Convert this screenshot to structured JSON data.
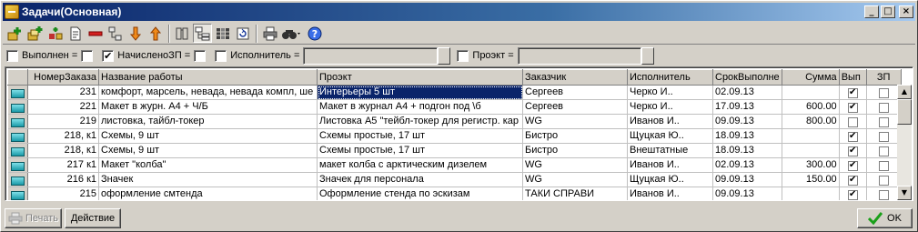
{
  "window": {
    "title": "Задачи(Основная)",
    "controls": {
      "minimize": "_",
      "maximize": "□",
      "close": "×"
    }
  },
  "toolbar": {
    "icons": [
      "add-icon",
      "add-copy-icon",
      "move-icon",
      "document-icon",
      "delete-icon",
      "tree-icon",
      "arrow-down-icon",
      "arrow-up-icon",
      "filter-icon",
      "hierarchy-icon",
      "columns-icon",
      "refresh-icon",
      "print-icon",
      "find-icon",
      "help-icon"
    ]
  },
  "filters": {
    "done_label": "Выполнен =",
    "accrued_label": "НачисленоЗП =",
    "accrued_checked": true,
    "executor_label": "Исполнитель =",
    "executor_value": "",
    "project_label": "Проэкт =",
    "project_value": ""
  },
  "table": {
    "columns": [
      "НомерЗаказа",
      "Название работы",
      "Проэкт",
      "Заказчик",
      "Исполнитель",
      "СрокВыполне",
      "Сумма",
      "Вып",
      "ЗП"
    ],
    "rows": [
      {
        "order": "231",
        "name": "комфорт, марсель, невада, невада  компл, ше",
        "project": "Интерьеры 5 шт",
        "customer": "Сергеев",
        "executor": "Черко И..",
        "deadline": "02.09.13",
        "sum": "",
        "done": true,
        "zp": false
      },
      {
        "order": "221",
        "name": "Макет в журн. А4 + Ч/Б",
        "project": "Макет в журнал А4 + подгон под \\б",
        "customer": "Сергеев",
        "executor": "Черко И..",
        "deadline": "17.09.13",
        "sum": "600.00",
        "done": true,
        "zp": false
      },
      {
        "order": "219",
        "name": "листовка, тайбл-токер",
        "project": "Листовка А5 \"тейбл-токер для регистр. кар",
        "customer": "WG",
        "executor": "Иванов И..",
        "deadline": "09.09.13",
        "sum": "800.00",
        "done": false,
        "zp": false
      },
      {
        "order": "218, к1",
        "name": "Схемы, 9 шт",
        "project": "Схемы простые, 17 шт",
        "customer": "Бистро",
        "executor": "Щуцкая Ю..",
        "deadline": "18.09.13",
        "sum": "",
        "done": true,
        "zp": false
      },
      {
        "order": "218, к1",
        "name": "Схемы, 9 шт",
        "project": "Схемы простые, 17 шт",
        "customer": "Бистро",
        "executor": "Внештатные",
        "deadline": "18.09.13",
        "sum": "",
        "done": true,
        "zp": false
      },
      {
        "order": "217 к1",
        "name": "Макет \"колба\"",
        "project": "макет колба с арктическим дизелем",
        "customer": "WG",
        "executor": "Иванов И..",
        "deadline": "02.09.13",
        "sum": "300.00",
        "done": true,
        "zp": false
      },
      {
        "order": "216 к1",
        "name": "Значек",
        "project": "Значек для персонала",
        "customer": "WG",
        "executor": "Щуцкая Ю..",
        "deadline": "09.09.13",
        "sum": "150.00",
        "done": true,
        "zp": false
      },
      {
        "order": "215",
        "name": "оформление смтенда",
        "project": "Оформление стенда по эскизам",
        "customer": "ТАКИ СПРАВИ",
        "executor": "Иванов И..",
        "deadline": "09.09.13",
        "sum": "",
        "done": true,
        "zp": false
      }
    ]
  },
  "footer": {
    "print_label": "Печать",
    "action_label": "Действие",
    "ok_label": "OK",
    "ok_icon": "checkmark-icon",
    "print_icon": "printer-icon"
  },
  "colors": {
    "selection": "#0a246a",
    "titlebar": "#0a246a",
    "face": "#d4d0c8"
  }
}
